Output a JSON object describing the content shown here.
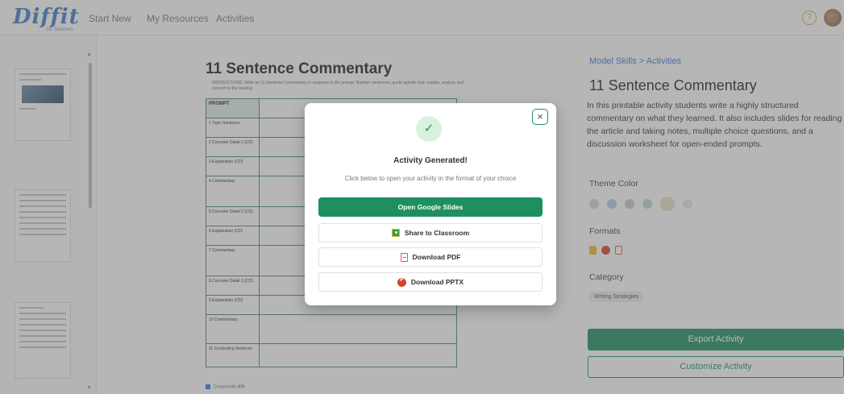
{
  "nav": {
    "logo": "Diffit",
    "logo_sub": "for Teachers",
    "links": [
      "Start New",
      "My Resources",
      "Activities"
    ],
    "help_symbol": "?"
  },
  "document": {
    "title": "11 Sentence Commentary",
    "instructions": "INSTRUCTIONS: Write an 11 Sentence Commentary in response to the prompt. Number sentences, quote specific text, explain, analyze and connect to the reading.",
    "rows": [
      "PROMPT",
      "1 Topic Sentence",
      "2 Concrete Detail 1 (CD)",
      "3 Explanation (CD)",
      "4 Commentary",
      "5 Concrete Detail 2 (CD)",
      "6 Explanation (CD)",
      "7 Commentary",
      "8 Concrete Detail 3 (CD)",
      "9 Explanation (CD)",
      "10 Commentary",
      "11 Concluding Sentence"
    ],
    "footer": "Created with diffit"
  },
  "panel": {
    "breadcrumb": "Model Skills > Activities",
    "title": "11 Sentence Commentary",
    "description": "In this printable activity students write a highly structured commentary on what they learned. It also includes slides for reading the article and taking notes, multiple choice questions, and a discussion worksheet for open-ended prompts.",
    "theme_label": "Theme Color",
    "theme_colors": [
      "#cfd8de",
      "#b9cde2",
      "#c9c9c9",
      "#bcd9c4",
      "#ebe2c2",
      "#e8e8e8"
    ],
    "formats_label": "Formats",
    "format_icons": [
      "slides-icon",
      "pptx-icon",
      "pdf-icon"
    ],
    "category_label": "Category",
    "category": "Writing Strategies",
    "export_label": "Export Activity",
    "customize_label": "Customize Activity"
  },
  "modal": {
    "close_symbol": "×",
    "check_symbol": "✓",
    "title": "Activity Generated!",
    "subtitle": "Click below to open your activity in the format of your choice",
    "buttons": [
      "Open Google Slides",
      "Share to Classroom",
      "Download PDF",
      "Download PPTX"
    ],
    "accent": "#1f8f60"
  }
}
